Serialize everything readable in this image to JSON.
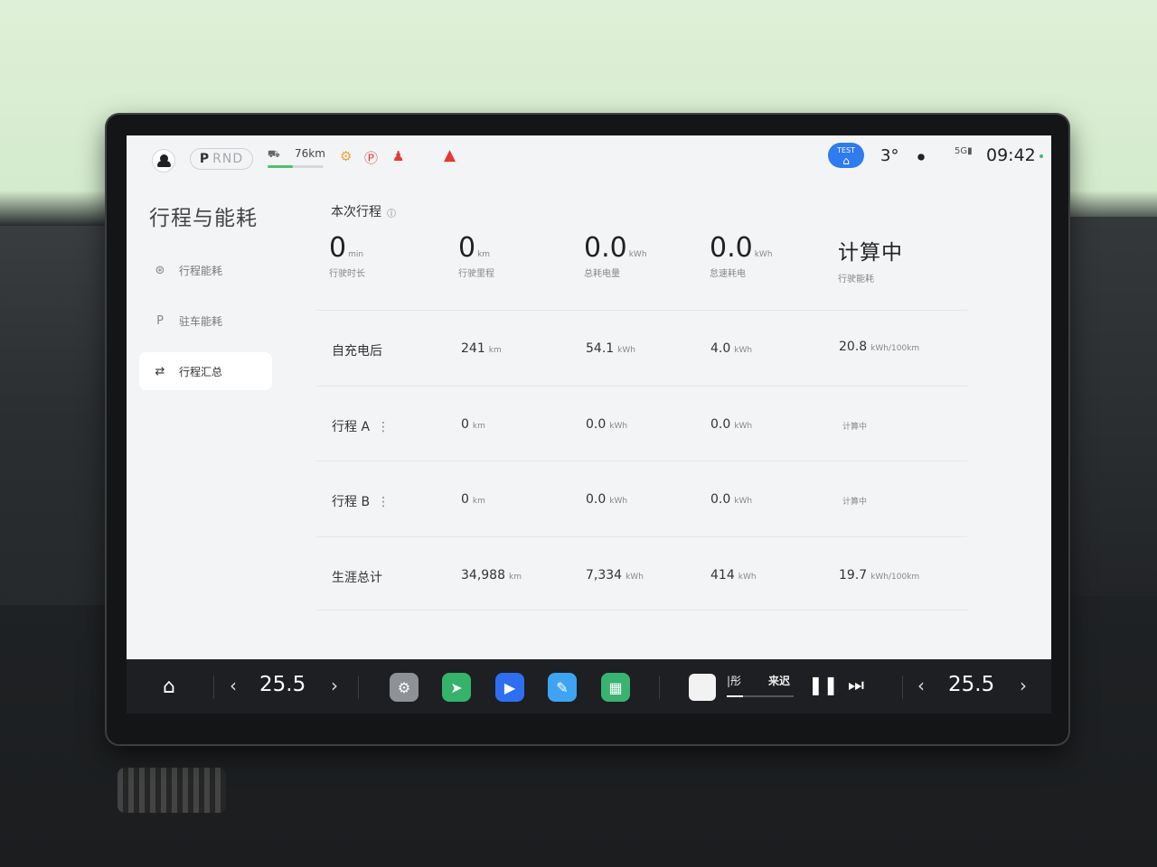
{
  "status": {
    "gear_p": "P",
    "gear_rnd": "RND",
    "range_km": "76km",
    "range_fill_pct": 45,
    "test_tag": "TEST",
    "outside_temp": "3°",
    "clock": "09:42",
    "signal_label": "5G"
  },
  "sidebar": {
    "title": "行程与能耗",
    "items": [
      {
        "label": "行程能耗",
        "icon": "steering-wheel-icon"
      },
      {
        "label": "驻车能耗",
        "icon": "parking-icon"
      },
      {
        "label": "行程汇总",
        "icon": "swap-arrows-icon",
        "active": true
      }
    ]
  },
  "current_trip": {
    "title": "本次行程",
    "metrics": [
      {
        "value": "0",
        "unit": "min",
        "label": "行驶时长"
      },
      {
        "value": "0",
        "unit": "km",
        "label": "行驶里程"
      },
      {
        "value": "0.0",
        "unit": "kWh",
        "label": "总耗电量"
      },
      {
        "value": "0.0",
        "unit": "kWh",
        "label": "怠速耗电"
      },
      {
        "value": "计算中",
        "unit": "",
        "label": "行驶能耗"
      }
    ]
  },
  "rows": [
    {
      "name": "自充电后",
      "distance": "241",
      "energy": "54.1",
      "idle": "4.0",
      "consumption": "20.8",
      "consumption_unit": "kWh/100km"
    },
    {
      "name": "行程 A",
      "more": "⋮",
      "distance": "0",
      "energy": "0.0",
      "idle": "0.0",
      "consumption": "计算中",
      "consumption_unit": ""
    },
    {
      "name": "行程 B",
      "more": "⋮",
      "distance": "0",
      "energy": "0.0",
      "idle": "0.0",
      "consumption": "计算中",
      "consumption_unit": ""
    },
    {
      "name": "生涯总计",
      "distance": "34,988",
      "energy": "7,334",
      "idle": "414",
      "consumption": "19.7",
      "consumption_unit": "kWh/100km"
    }
  ],
  "units": {
    "km": "km",
    "kwh": "kWh"
  },
  "dock": {
    "left_temp": "25.5",
    "right_temp": "25.5",
    "music_text_1": "|彤",
    "music_text_2": "来迟",
    "music_progress": 0.24
  },
  "colors": {
    "accent_blue": "#2f7bf0",
    "range_green": "#4cc36a",
    "warning_red": "#e53935"
  }
}
